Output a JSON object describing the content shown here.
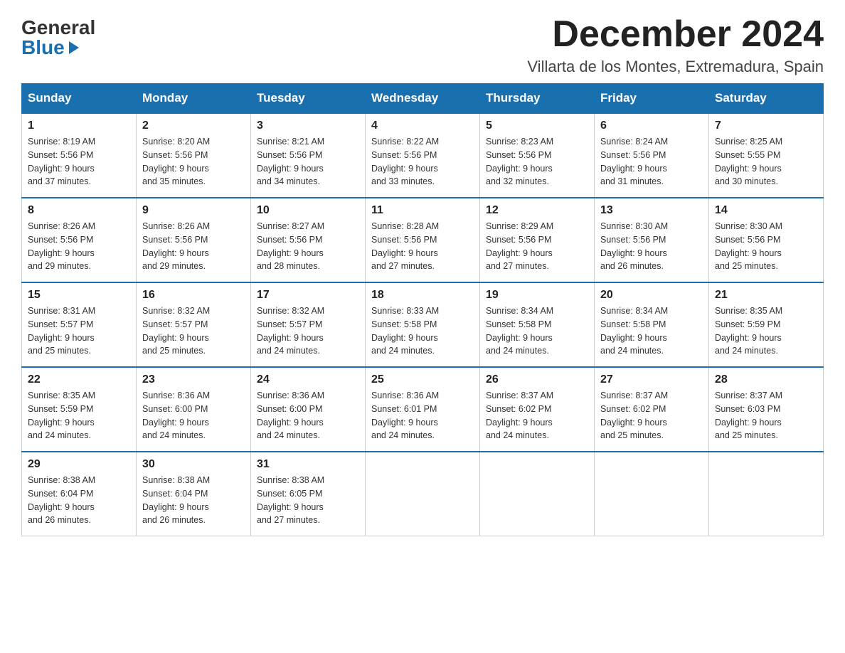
{
  "header": {
    "logo_general": "General",
    "logo_blue": "Blue",
    "month_title": "December 2024",
    "location": "Villarta de los Montes, Extremadura, Spain"
  },
  "days_of_week": [
    "Sunday",
    "Monday",
    "Tuesday",
    "Wednesday",
    "Thursday",
    "Friday",
    "Saturday"
  ],
  "weeks": [
    [
      {
        "day": "1",
        "sunrise": "8:19 AM",
        "sunset": "5:56 PM",
        "daylight": "9 hours and 37 minutes."
      },
      {
        "day": "2",
        "sunrise": "8:20 AM",
        "sunset": "5:56 PM",
        "daylight": "9 hours and 35 minutes."
      },
      {
        "day": "3",
        "sunrise": "8:21 AM",
        "sunset": "5:56 PM",
        "daylight": "9 hours and 34 minutes."
      },
      {
        "day": "4",
        "sunrise": "8:22 AM",
        "sunset": "5:56 PM",
        "daylight": "9 hours and 33 minutes."
      },
      {
        "day": "5",
        "sunrise": "8:23 AM",
        "sunset": "5:56 PM",
        "daylight": "9 hours and 32 minutes."
      },
      {
        "day": "6",
        "sunrise": "8:24 AM",
        "sunset": "5:56 PM",
        "daylight": "9 hours and 31 minutes."
      },
      {
        "day": "7",
        "sunrise": "8:25 AM",
        "sunset": "5:55 PM",
        "daylight": "9 hours and 30 minutes."
      }
    ],
    [
      {
        "day": "8",
        "sunrise": "8:26 AM",
        "sunset": "5:56 PM",
        "daylight": "9 hours and 29 minutes."
      },
      {
        "day": "9",
        "sunrise": "8:26 AM",
        "sunset": "5:56 PM",
        "daylight": "9 hours and 29 minutes."
      },
      {
        "day": "10",
        "sunrise": "8:27 AM",
        "sunset": "5:56 PM",
        "daylight": "9 hours and 28 minutes."
      },
      {
        "day": "11",
        "sunrise": "8:28 AM",
        "sunset": "5:56 PM",
        "daylight": "9 hours and 27 minutes."
      },
      {
        "day": "12",
        "sunrise": "8:29 AM",
        "sunset": "5:56 PM",
        "daylight": "9 hours and 27 minutes."
      },
      {
        "day": "13",
        "sunrise": "8:30 AM",
        "sunset": "5:56 PM",
        "daylight": "9 hours and 26 minutes."
      },
      {
        "day": "14",
        "sunrise": "8:30 AM",
        "sunset": "5:56 PM",
        "daylight": "9 hours and 25 minutes."
      }
    ],
    [
      {
        "day": "15",
        "sunrise": "8:31 AM",
        "sunset": "5:57 PM",
        "daylight": "9 hours and 25 minutes."
      },
      {
        "day": "16",
        "sunrise": "8:32 AM",
        "sunset": "5:57 PM",
        "daylight": "9 hours and 25 minutes."
      },
      {
        "day": "17",
        "sunrise": "8:32 AM",
        "sunset": "5:57 PM",
        "daylight": "9 hours and 24 minutes."
      },
      {
        "day": "18",
        "sunrise": "8:33 AM",
        "sunset": "5:58 PM",
        "daylight": "9 hours and 24 minutes."
      },
      {
        "day": "19",
        "sunrise": "8:34 AM",
        "sunset": "5:58 PM",
        "daylight": "9 hours and 24 minutes."
      },
      {
        "day": "20",
        "sunrise": "8:34 AM",
        "sunset": "5:58 PM",
        "daylight": "9 hours and 24 minutes."
      },
      {
        "day": "21",
        "sunrise": "8:35 AM",
        "sunset": "5:59 PM",
        "daylight": "9 hours and 24 minutes."
      }
    ],
    [
      {
        "day": "22",
        "sunrise": "8:35 AM",
        "sunset": "5:59 PM",
        "daylight": "9 hours and 24 minutes."
      },
      {
        "day": "23",
        "sunrise": "8:36 AM",
        "sunset": "6:00 PM",
        "daylight": "9 hours and 24 minutes."
      },
      {
        "day": "24",
        "sunrise": "8:36 AM",
        "sunset": "6:00 PM",
        "daylight": "9 hours and 24 minutes."
      },
      {
        "day": "25",
        "sunrise": "8:36 AM",
        "sunset": "6:01 PM",
        "daylight": "9 hours and 24 minutes."
      },
      {
        "day": "26",
        "sunrise": "8:37 AM",
        "sunset": "6:02 PM",
        "daylight": "9 hours and 24 minutes."
      },
      {
        "day": "27",
        "sunrise": "8:37 AM",
        "sunset": "6:02 PM",
        "daylight": "9 hours and 25 minutes."
      },
      {
        "day": "28",
        "sunrise": "8:37 AM",
        "sunset": "6:03 PM",
        "daylight": "9 hours and 25 minutes."
      }
    ],
    [
      {
        "day": "29",
        "sunrise": "8:38 AM",
        "sunset": "6:04 PM",
        "daylight": "9 hours and 26 minutes."
      },
      {
        "day": "30",
        "sunrise": "8:38 AM",
        "sunset": "6:04 PM",
        "daylight": "9 hours and 26 minutes."
      },
      {
        "day": "31",
        "sunrise": "8:38 AM",
        "sunset": "6:05 PM",
        "daylight": "9 hours and 27 minutes."
      },
      null,
      null,
      null,
      null
    ]
  ],
  "labels": {
    "sunrise": "Sunrise:",
    "sunset": "Sunset:",
    "daylight": "Daylight:"
  }
}
